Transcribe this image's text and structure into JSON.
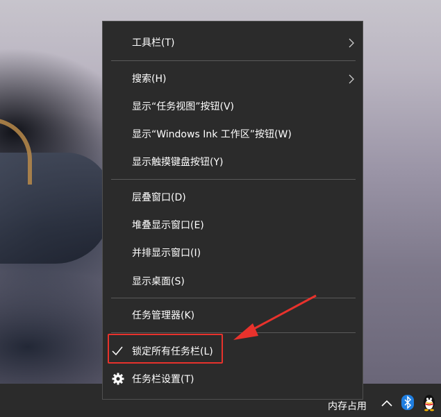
{
  "menu": {
    "items": [
      {
        "label": "工具栏(T)",
        "submenu": true
      },
      {
        "label": "搜索(H)",
        "submenu": true
      },
      {
        "label": "显示“任务视图”按钮(V)"
      },
      {
        "label": "显示“Windows Ink 工作区”按钮(W)"
      },
      {
        "label": "显示触摸键盘按钮(Y)"
      },
      {
        "label": "层叠窗口(D)"
      },
      {
        "label": "堆叠显示窗口(E)"
      },
      {
        "label": "并排显示窗口(I)"
      },
      {
        "label": "显示桌面(S)"
      },
      {
        "label": "任务管理器(K)"
      },
      {
        "label": "锁定所有任务栏(L)",
        "checked": true,
        "icon": "checkmark-icon"
      },
      {
        "label": "任务栏设置(T)",
        "icon": "gear-icon"
      }
    ]
  },
  "taskbar": {
    "tray_text": "内存占用",
    "tray_icons": [
      "chevron-up-icon",
      "bluetooth-icon",
      "qq-penguin-icon"
    ]
  },
  "annotation": {
    "color": "#e8322c",
    "highlighted_item": "锁定所有任务栏(L)"
  },
  "colors": {
    "menu_bg": "#2b2b2b",
    "menu_text": "#ffffff",
    "separator": "#5a5a5a",
    "taskbar_bg": "#2b2b2b"
  }
}
